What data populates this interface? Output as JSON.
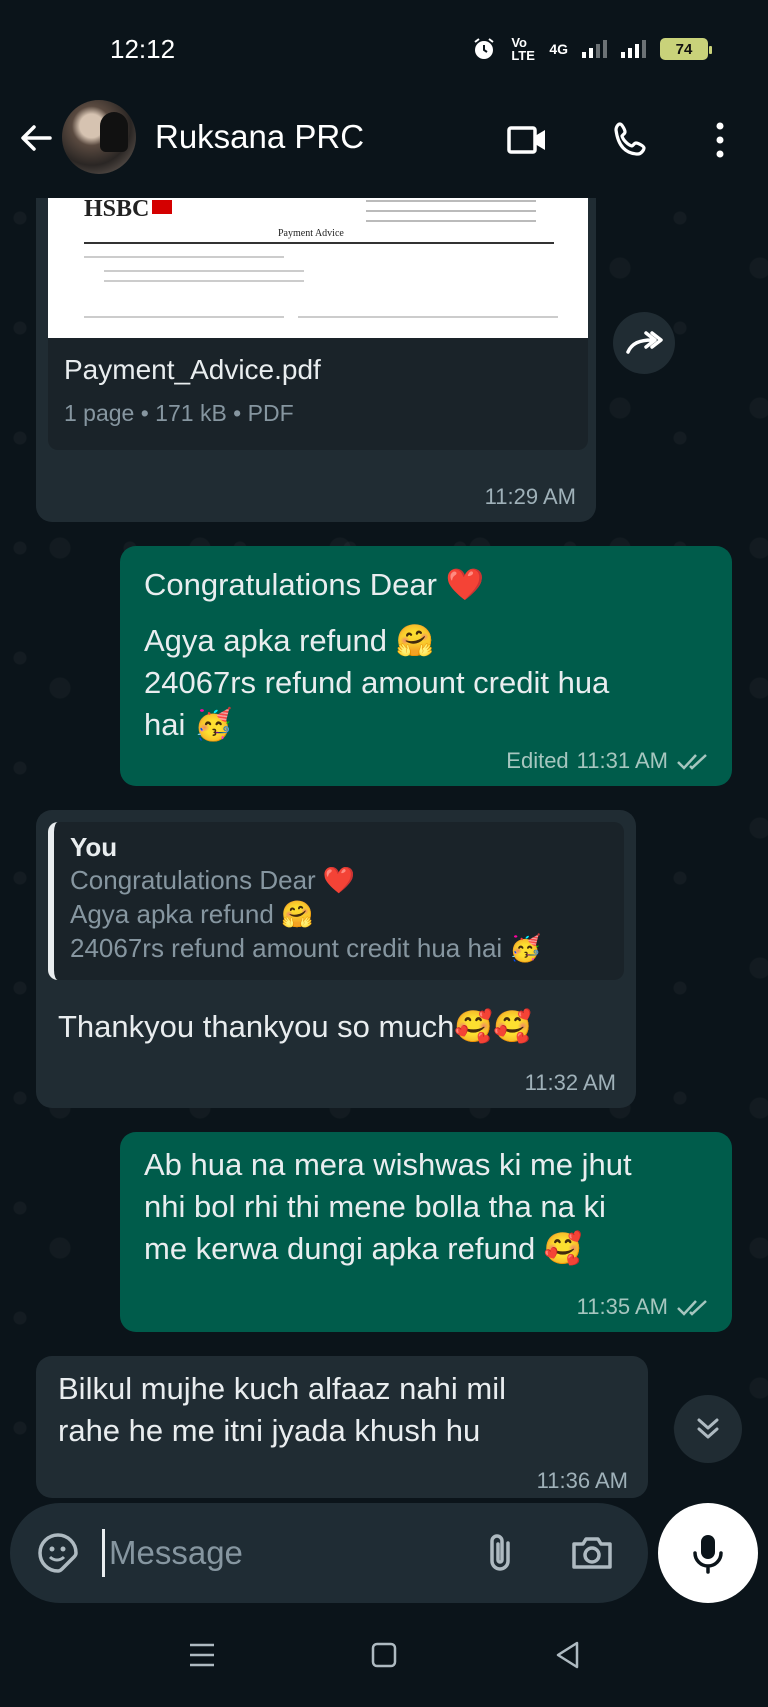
{
  "status_bar": {
    "time": "12:12",
    "network_label": "Vo LTE",
    "network_type": "4G",
    "battery": "74"
  },
  "header": {
    "contact_name": "Ruksana PRC",
    "icons": [
      "back-arrow-icon",
      "video-call-icon",
      "voice-call-icon",
      "more-options-icon"
    ]
  },
  "messages": [
    {
      "type": "document",
      "direction": "incoming",
      "preview_header": "HSBC",
      "preview_title": "Payment Advice",
      "file_name": "Payment_Advice.pdf",
      "file_info": "1 page • 171 kB • PDF",
      "time": "11:29 AM"
    },
    {
      "type": "text",
      "direction": "outgoing",
      "lines": [
        "Congratulations Dear ❤️",
        "Agya apka refund 🤗",
        "24067rs refund amount credit hua",
        "hai 🥳"
      ],
      "edited_label": "Edited",
      "time": "11:31 AM",
      "status": "read"
    },
    {
      "type": "reply",
      "direction": "incoming",
      "quote_author": "You",
      "quote_lines": [
        "Congratulations Dear ❤️",
        "Agya apka refund 🤗",
        "24067rs refund amount credit hua hai 🥳"
      ],
      "text": "Thankyou thankyou so much🥰🥰",
      "time": "11:32 AM"
    },
    {
      "type": "text",
      "direction": "outgoing",
      "lines": [
        "Ab hua na mera wishwas ki me jhut",
        "nhi bol rhi thi mene bolla tha na ki",
        "me kerwa dungi apka refund 🥰"
      ],
      "time": "11:35 AM",
      "status": "read"
    },
    {
      "type": "text",
      "direction": "incoming",
      "lines": [
        "Bilkul mujhe kuch alfaaz nahi mil",
        "rahe he me itni jyada khush hu"
      ],
      "time": "11:36 AM"
    }
  ],
  "composer": {
    "placeholder": "Message",
    "icons": [
      "sticker-icon",
      "attach-icon",
      "camera-icon",
      "mic-icon"
    ]
  },
  "nav_bar": {
    "icons": [
      "recents-icon",
      "home-icon",
      "back-icon"
    ]
  },
  "colors": {
    "background": "#0b141a",
    "incoming_bubble": "#202c33",
    "outgoing_bubble": "#005c4b",
    "read_ticks": "#a6c6bf"
  }
}
